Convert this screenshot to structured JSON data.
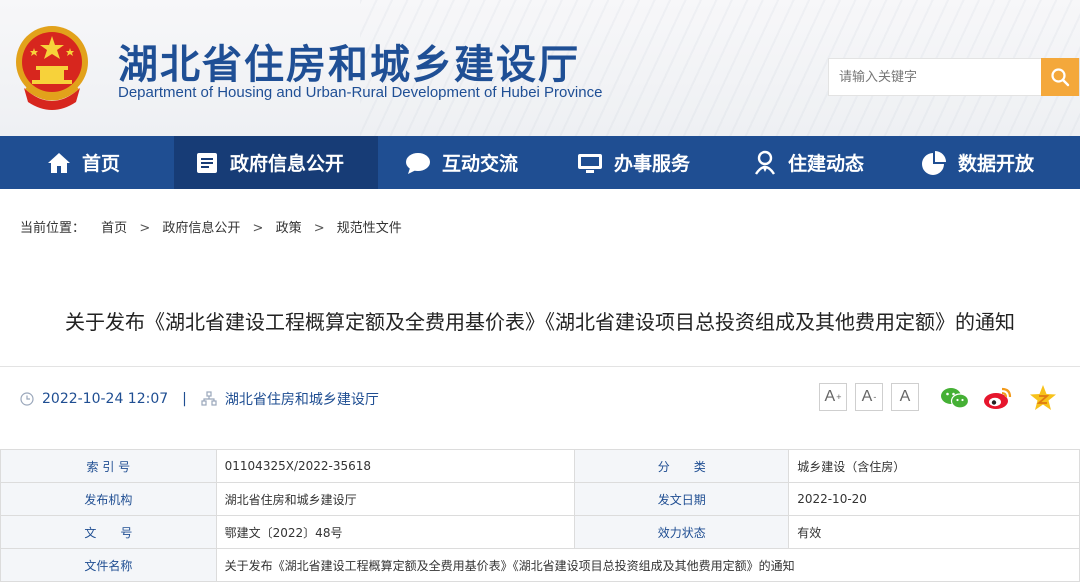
{
  "header": {
    "title": "湖北省住房和城乡建设厅",
    "subtitle": "Department of Housing and Urban-Rural Development of Hubei Province",
    "search_placeholder": "请输入关键字",
    "colors": {
      "brand_blue": "#1f4f95",
      "accent_orange": "#f4a83b"
    }
  },
  "nav": {
    "items": [
      {
        "label": "首页",
        "icon": "home-icon"
      },
      {
        "label": "政府信息公开",
        "icon": "document-list-icon",
        "active": true
      },
      {
        "label": "互动交流",
        "icon": "chat-bubble-icon"
      },
      {
        "label": "办事服务",
        "icon": "monitor-icon"
      },
      {
        "label": "住建动态",
        "icon": "person-badge-icon"
      },
      {
        "label": "数据开放",
        "icon": "pie-chart-icon"
      }
    ]
  },
  "breadcrumb": {
    "label": "当前位置：",
    "items": [
      "首页",
      "政府信息公开",
      "政策",
      "规范性文件"
    ],
    "separator": ">"
  },
  "article": {
    "title": "关于发布《湖北省建设工程概算定额及全费用基价表》《湖北省建设项目总投资组成及其他费用定额》的通知",
    "datetime": "2022-10-24 12:07",
    "pipe": "|",
    "source": "湖北省住房和城乡建设厅"
  },
  "font_controls": [
    {
      "label": "A",
      "sup": "+"
    },
    {
      "label": "A",
      "sup": "-"
    },
    {
      "label": "A",
      "sup": ""
    }
  ],
  "share_icons": [
    "wechat-icon",
    "weibo-icon",
    "qzone-icon"
  ],
  "info_table": {
    "rows": [
      {
        "label1": "索 引 号",
        "value1": "01104325X/2022-35618",
        "label2": "分　　类",
        "value2": "城乡建设（含住房）"
      },
      {
        "label1": "发布机构",
        "value1": "湖北省住房和城乡建设厅",
        "label2": "发文日期",
        "value2": "2022-10-20"
      },
      {
        "label1": "文　　号",
        "value1": "鄂建文〔2022〕48号",
        "label2": "效力状态",
        "value2": "有效"
      },
      {
        "label1": "文件名称",
        "value1": "关于发布《湖北省建设工程概算定额及全费用基价表》《湖北省建设项目总投资组成及其他费用定额》的通知"
      }
    ]
  }
}
